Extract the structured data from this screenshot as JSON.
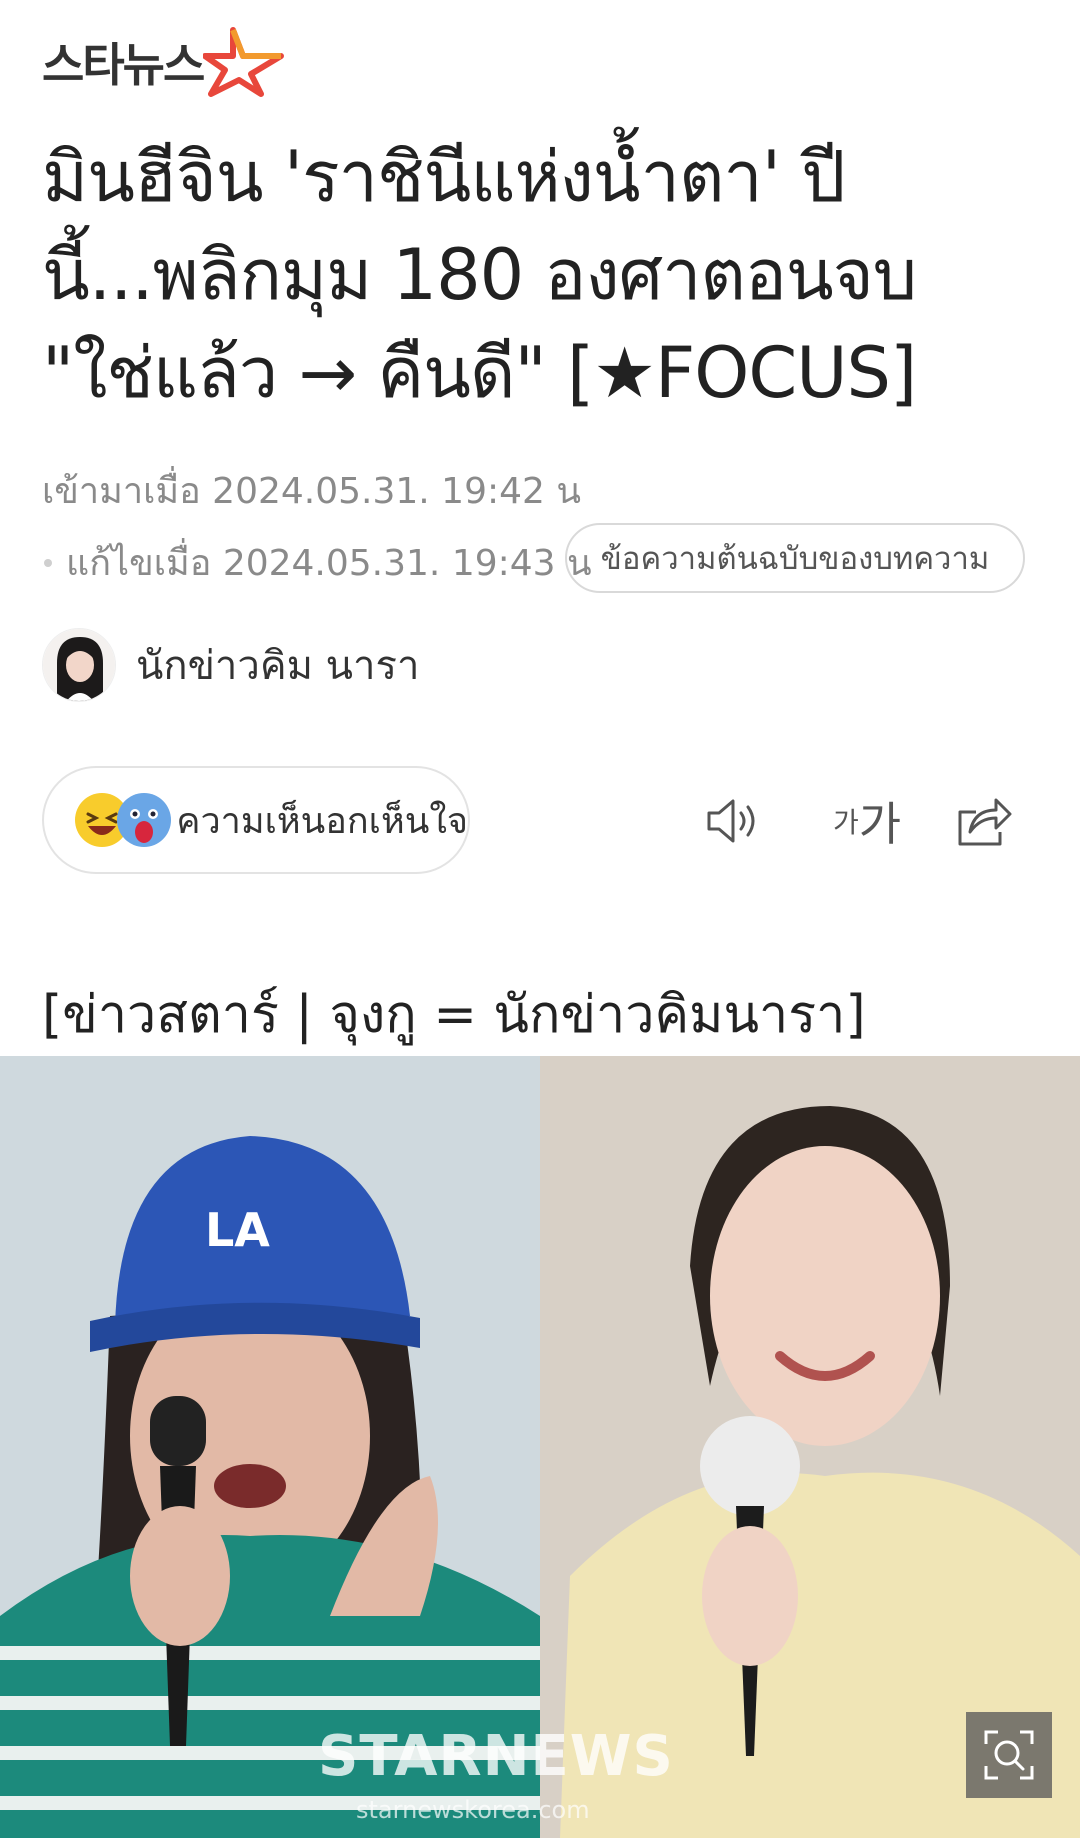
{
  "header": {
    "logo_text": "스타뉴스",
    "logo_icon": "star-logo-icon",
    "logo_color": "#e8473b"
  },
  "article": {
    "headline": "มินฮีจิน 'ราชินีแห่งน้ำตา' ปีนี้...พลิกมุม 180 องศาตอนจบ \"ใช่แล้ว → คืนดี\" [★FOCUS]",
    "published_label": "เข้ามาเมื่อ 2024.05.31. 19:42 น",
    "updated_label": "แก้ไขเมื่อ 2024.05.31. 19:43 น",
    "original_button": "ข้อความต้นฉบับของบทความ",
    "reporter_name": "นักข่าวคิม นารา",
    "caption": "[ข่าวสตาร์ | จุงกู = นักข่าวคิมนารา]"
  },
  "actions": {
    "reaction_label": "ความเห็นอกเห็นใจ",
    "reaction_icons": [
      "laughing-emoji-icon",
      "shocked-emoji-icon"
    ],
    "speaker_icon": "speaker-icon",
    "font_small": "가",
    "font_big": "가",
    "share_icon": "share-icon"
  },
  "photo": {
    "watermark": "STARNEWS",
    "watermark_sub": "starnewskorea.com",
    "zoom_icon": "zoom-search-icon"
  }
}
